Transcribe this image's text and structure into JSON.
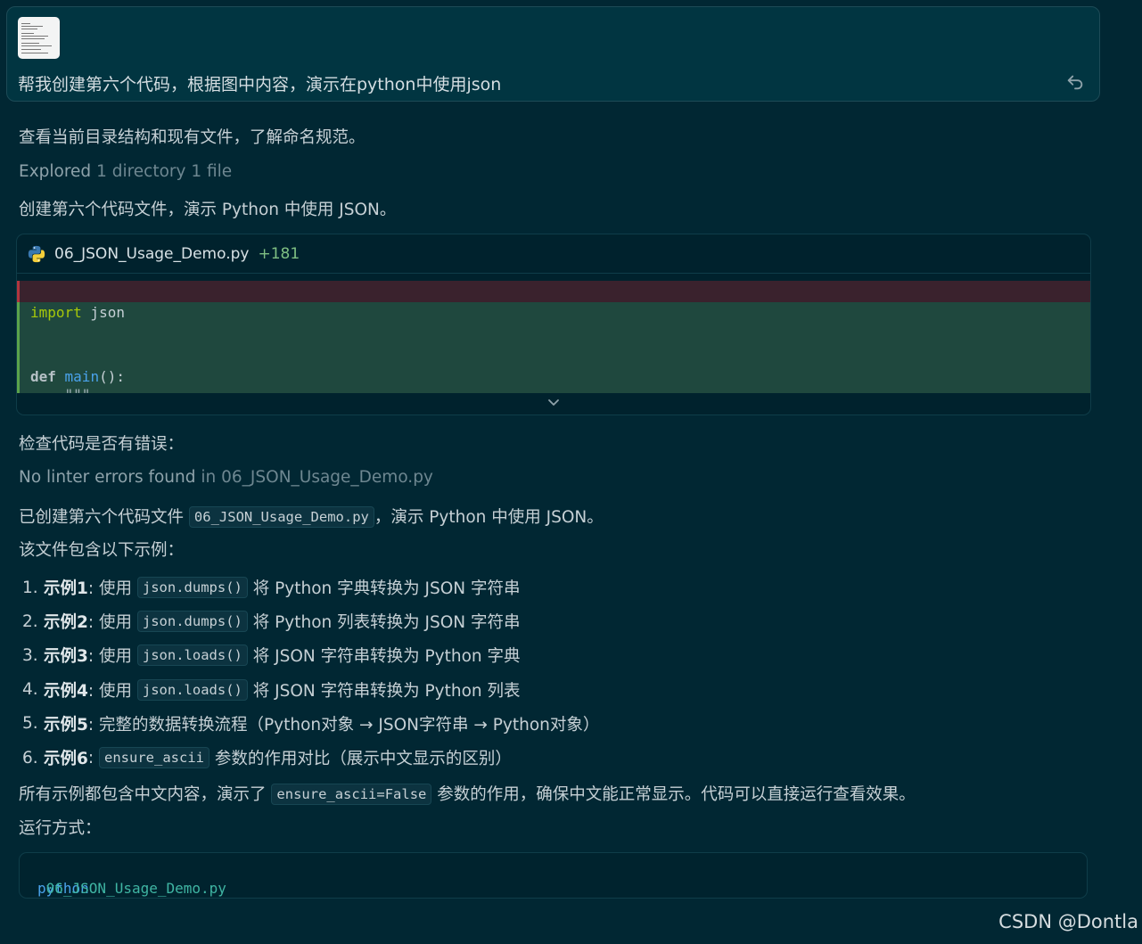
{
  "user_message": {
    "text": "帮我创建第六个代码，根据图中内容，演示在python中使用json",
    "attachment_icon": "image-thumbnail",
    "action_icon": "undo-icon"
  },
  "assistant": {
    "intro": "查看当前目录结构和现有文件，了解命名规范。",
    "explored_label": "Explored",
    "explored_detail": "1 directory 1 file",
    "create_msg": "创建第六个代码文件，演示 Python 中使用 JSON。",
    "code_card": {
      "file_icon": "python-icon",
      "filename": "06_JSON_Usage_Demo.py",
      "added_lines": "+181",
      "code": {
        "import_kw": "import",
        "import_name": " json",
        "def_kw": "def",
        "def_name": " main",
        "def_rest": "():",
        "partial_line": "    \"\"\""
      },
      "expand_icon": "chevron-down-icon"
    },
    "check_msg": "检查代码是否有错误：",
    "lint_status": "No linter errors found",
    "lint_file": "in 06_JSON_Usage_Demo.py",
    "created_prefix": "已创建第六个代码文件",
    "created_file": "06_JSON_Usage_Demo.py",
    "created_suffix": "，演示 Python 中使用 JSON。",
    "contains_msg": "该文件包含以下示例：",
    "examples": [
      {
        "num": "1.",
        "title": "示例1",
        "pre": ": 使用",
        "code": "json.dumps()",
        "post": "将 Python 字典转换为 JSON 字符串"
      },
      {
        "num": "2.",
        "title": "示例2",
        "pre": ": 使用",
        "code": "json.dumps()",
        "post": "将 Python 列表转换为 JSON 字符串"
      },
      {
        "num": "3.",
        "title": "示例3",
        "pre": ": 使用",
        "code": "json.loads()",
        "post": "将 JSON 字符串转换为 Python 字典"
      },
      {
        "num": "4.",
        "title": "示例4",
        "pre": ": 使用",
        "code": "json.loads()",
        "post": "将 JSON 字符串转换为 Python 列表"
      },
      {
        "num": "5.",
        "title": "示例5",
        "pre": ": 完整的数据转换流程（Python对象 → JSON字符串 → Python对象）",
        "code": "",
        "post": ""
      },
      {
        "num": "6.",
        "title": "示例6",
        "pre": ":",
        "code": "ensure_ascii",
        "post": "参数的作用对比（展示中文显示的区别）"
      }
    ],
    "summary_prefix": "所有示例都包含中文内容，演示了",
    "summary_code": "ensure_ascii=False",
    "summary_suffix": "参数的作用，确保中文能正常显示。代码可以直接运行查看效果。",
    "run_label": "运行方式：",
    "command": {
      "program": "python",
      "file": " 06_JSON_Usage_Demo.py"
    }
  },
  "watermark": "CSDN @Dontla"
}
